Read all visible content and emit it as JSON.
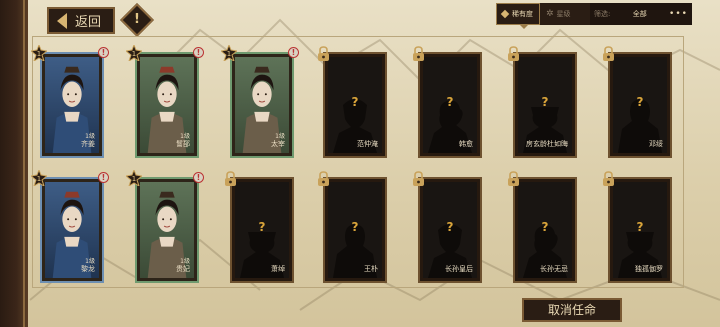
{
  "header": {
    "back_label": "返回",
    "info_icon": "!"
  },
  "sort": {
    "rarity_label": "稀有度",
    "star_label": "星级",
    "filter_label": "筛选:",
    "filter_value": "全部",
    "more": "•••"
  },
  "cards": [
    {
      "name": "齐姜",
      "level": "1级",
      "rarity": "blue",
      "unlocked": true
    },
    {
      "name": "鬙郚",
      "level": "1级",
      "rarity": "green",
      "unlocked": true
    },
    {
      "name": "太宰",
      "level": "1级",
      "rarity": "green",
      "unlocked": true
    },
    {
      "name": "范仲淹",
      "rarity": "gold",
      "unlocked": false
    },
    {
      "name": "韩愈",
      "rarity": "gold",
      "unlocked": false
    },
    {
      "name": "房玄龄杜如晦",
      "rarity": "gold",
      "unlocked": false
    },
    {
      "name": "邓绥",
      "rarity": "gold",
      "unlocked": false
    },
    {
      "name": "黎龙",
      "level": "1级",
      "rarity": "blue",
      "unlocked": true
    },
    {
      "name": "贵妃",
      "level": "1级",
      "rarity": "green",
      "unlocked": true
    },
    {
      "name": "萧绰",
      "rarity": "gold",
      "unlocked": false
    },
    {
      "name": "王朴",
      "rarity": "gold",
      "unlocked": false
    },
    {
      "name": "长孙皇后",
      "rarity": "gold",
      "unlocked": false
    },
    {
      "name": "长孙无忌",
      "rarity": "gold",
      "unlocked": false
    },
    {
      "name": "独孤伽罗",
      "rarity": "gold",
      "unlocked": false
    }
  ],
  "unknown_mark": "?",
  "alert_mark": "!",
  "footer": {
    "cancel_label": "取消任命"
  },
  "colors": {
    "blue_frame": "#6d8fb2",
    "green_frame": "#6f9a6f",
    "locked_frame": "#6e5230",
    "question": "#d9a43a"
  }
}
